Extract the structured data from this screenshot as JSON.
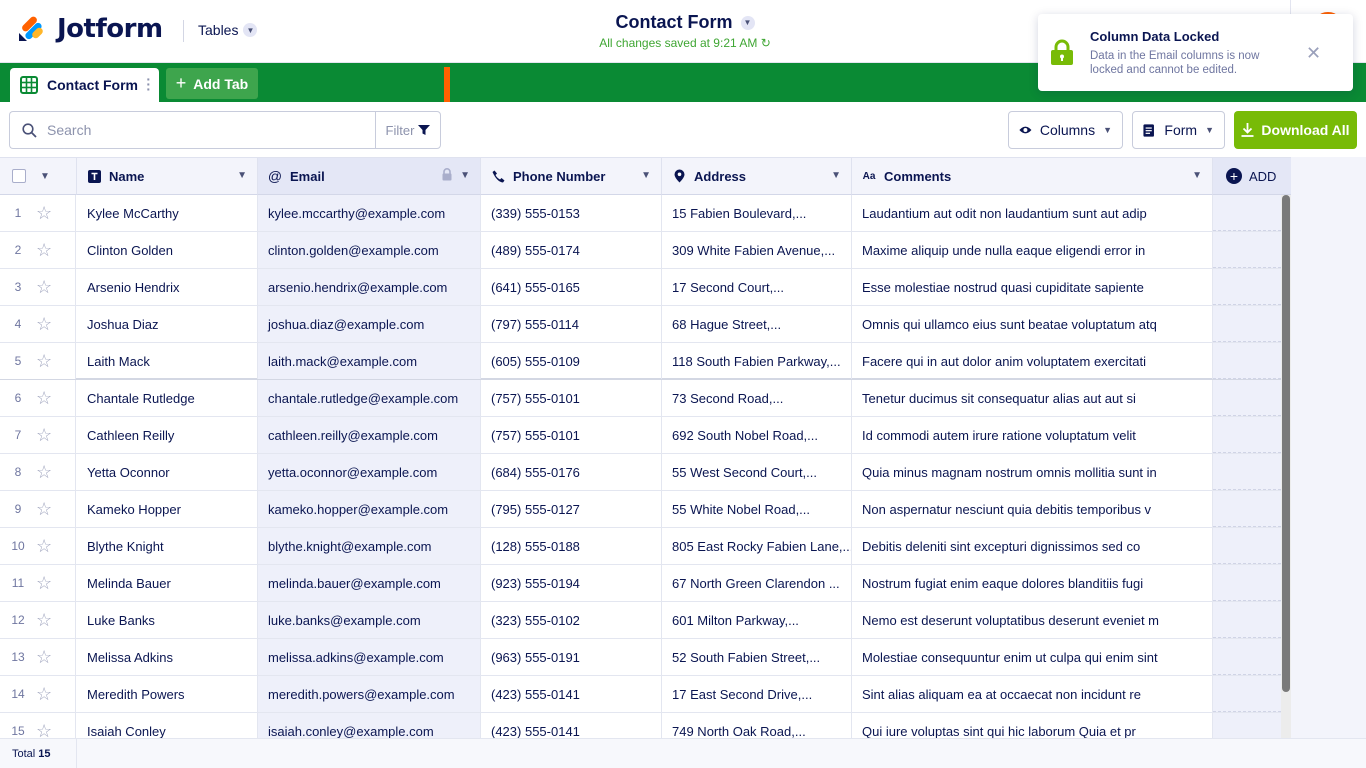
{
  "app": {
    "brand": "Jotform",
    "section_menu": "Tables",
    "table_title": "Contact Form",
    "save_status": "All changes saved at 9:21 AM"
  },
  "tabs": {
    "active_label": "Contact Form",
    "add_label": "Add Tab"
  },
  "toolbar": {
    "search_placeholder": "Search",
    "filter_label": "Filter",
    "columns_label": "Columns",
    "form_label": "Form",
    "download_label": "Download All"
  },
  "columns": [
    {
      "label": "Name",
      "icon": "text-type-icon"
    },
    {
      "label": "Email",
      "icon": "at-icon",
      "locked": true
    },
    {
      "label": "Phone Number",
      "icon": "phone-icon"
    },
    {
      "label": "Address",
      "icon": "location-pin-icon"
    },
    {
      "label": "Comments",
      "icon": "long-text-icon"
    }
  ],
  "add_column_label": "ADD",
  "rows": [
    {
      "num": "1",
      "name": "Kylee McCarthy",
      "email": "kylee.mccarthy@example.com",
      "phone": "(339) 555-0153",
      "address": "15 Fabien Boulevard,...",
      "comments": "Laudantium aut odit non laudantium sunt aut adip"
    },
    {
      "num": "2",
      "name": "Clinton Golden",
      "email": "clinton.golden@example.com",
      "phone": "(489) 555-0174",
      "address": "309 White Fabien Avenue,...",
      "comments": "Maxime aliquip unde nulla eaque eligendi error in"
    },
    {
      "num": "3",
      "name": "Arsenio Hendrix",
      "email": "arsenio.hendrix@example.com",
      "phone": "(641) 555-0165",
      "address": "17 Second Court,...",
      "comments": "Esse molestiae nostrud quasi cupiditate sapiente"
    },
    {
      "num": "4",
      "name": "Joshua Diaz",
      "email": "joshua.diaz@example.com",
      "phone": "(797) 555-0114",
      "address": "68 Hague Street,...",
      "comments": "Omnis qui ullamco eius sunt beatae voluptatum atq"
    },
    {
      "num": "5",
      "name": "Laith Mack",
      "email": "laith.mack@example.com",
      "phone": "(605) 555-0109",
      "address": "118 South Fabien Parkway,...",
      "comments": "Facere qui in aut dolor anim voluptatem exercitati"
    },
    {
      "num": "6",
      "name": "Chantale Rutledge",
      "email": "chantale.rutledge@example.com",
      "phone": "(757) 555-0101",
      "address": "73 Second Road,...",
      "comments": "Tenetur ducimus sit consequatur alias aut aut si"
    },
    {
      "num": "7",
      "name": "Cathleen Reilly",
      "email": "cathleen.reilly@example.com",
      "phone": "(757) 555-0101",
      "address": "692 South Nobel Road,...",
      "comments": "Id commodi autem irure ratione voluptatum velit"
    },
    {
      "num": "8",
      "name": "Yetta Oconnor",
      "email": "yetta.oconnor@example.com",
      "phone": "(684) 555-0176",
      "address": "55 West Second Court,...",
      "comments": "Quia minus magnam nostrum omnis mollitia sunt in"
    },
    {
      "num": "9",
      "name": "Kameko Hopper",
      "email": "kameko.hopper@example.com",
      "phone": "(795) 555-0127",
      "address": "55 White Nobel Road,...",
      "comments": "Non aspernatur nesciunt quia debitis temporibus v"
    },
    {
      "num": "10",
      "name": "Blythe Knight",
      "email": "blythe.knight@example.com",
      "phone": "(128) 555-0188",
      "address": "805 East Rocky Fabien Lane,...",
      "comments": "Debitis deleniti sint excepturi dignissimos sed co"
    },
    {
      "num": "11",
      "name": "Melinda Bauer",
      "email": "melinda.bauer@example.com",
      "phone": "(923) 555-0194",
      "address": "67 North Green Clarendon ...",
      "comments": "Nostrum fugiat enim eaque dolores blanditiis fugi"
    },
    {
      "num": "12",
      "name": "Luke Banks",
      "email": "luke.banks@example.com",
      "phone": "(323) 555-0102",
      "address": "601 Milton Parkway,...",
      "comments": "Nemo est deserunt voluptatibus deserunt eveniet m"
    },
    {
      "num": "13",
      "name": "Melissa Adkins",
      "email": "melissa.adkins@example.com",
      "phone": "(963) 555-0191",
      "address": "52 South Fabien Street,...",
      "comments": "Molestiae consequuntur enim ut culpa qui enim sint"
    },
    {
      "num": "14",
      "name": "Meredith Powers",
      "email": "meredith.powers@example.com",
      "phone": "(423) 555-0141",
      "address": "17 East Second Drive,...",
      "comments": "Sint alias aliquam ea at occaecat non incidunt re"
    },
    {
      "num": "15",
      "name": "Isaiah Conley",
      "email": "isaiah.conley@example.com",
      "phone": "(423) 555-0141",
      "address": "749 North Oak Road,...",
      "comments": "Qui iure voluptas sint qui hic laborum Quia et pr"
    }
  ],
  "footer": {
    "total_label": "Total",
    "total_count": "15"
  },
  "toast": {
    "title": "Column Data Locked",
    "message": "Data in the Email columns is now locked and cannot be edited."
  },
  "colors": {
    "brand_green": "#0a8a34",
    "download_green": "#78bb07",
    "navy": "#0a1551",
    "annotation_orange": "#ff6100"
  }
}
